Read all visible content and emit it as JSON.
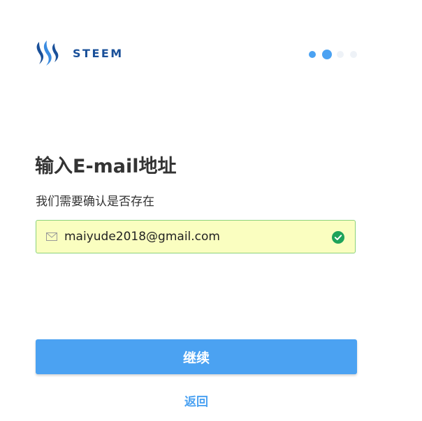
{
  "header": {
    "brand": "STEEM",
    "logo_icon": "steem-logo-icon",
    "progress": {
      "total_steps": 4,
      "current_step": 2
    }
  },
  "main": {
    "title": "输入E-mail地址",
    "subtitle": "我们需要确认是否存在",
    "email": {
      "value": "maiyude2018@gmail.com",
      "icon": "mail-icon",
      "status_icon": "check-circle-icon",
      "status": "valid"
    },
    "continue_label": "继续",
    "back_label": "返回"
  },
  "colors": {
    "brand": "#1a5099",
    "accent": "#4ba2f2",
    "input_bg": "#fafec0",
    "input_border": "#8bd27a",
    "success": "#1ea35a"
  }
}
